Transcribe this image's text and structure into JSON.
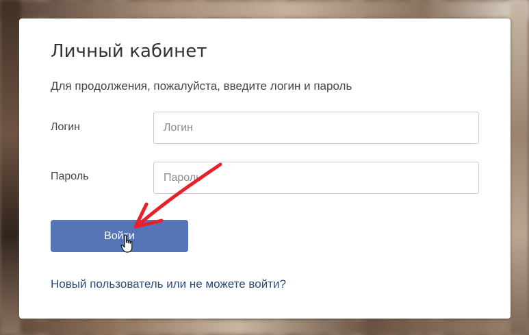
{
  "login_card": {
    "title": "Личный кабинет",
    "subtitle": "Для продолжения, пожалуйста, введите логин и пароль",
    "login_label": "Логин",
    "login_placeholder": "Логин",
    "password_label": "Пароль",
    "password_placeholder": "Пароль",
    "submit_label": "Войти",
    "help_link": "Новый пользователь или не можете войти?"
  },
  "annotation": {
    "arrow_color": "#e8202a",
    "cursor_icon": "hand-pointer-icon"
  },
  "colors": {
    "button": "#5575b6",
    "link": "#2b4a7a"
  }
}
